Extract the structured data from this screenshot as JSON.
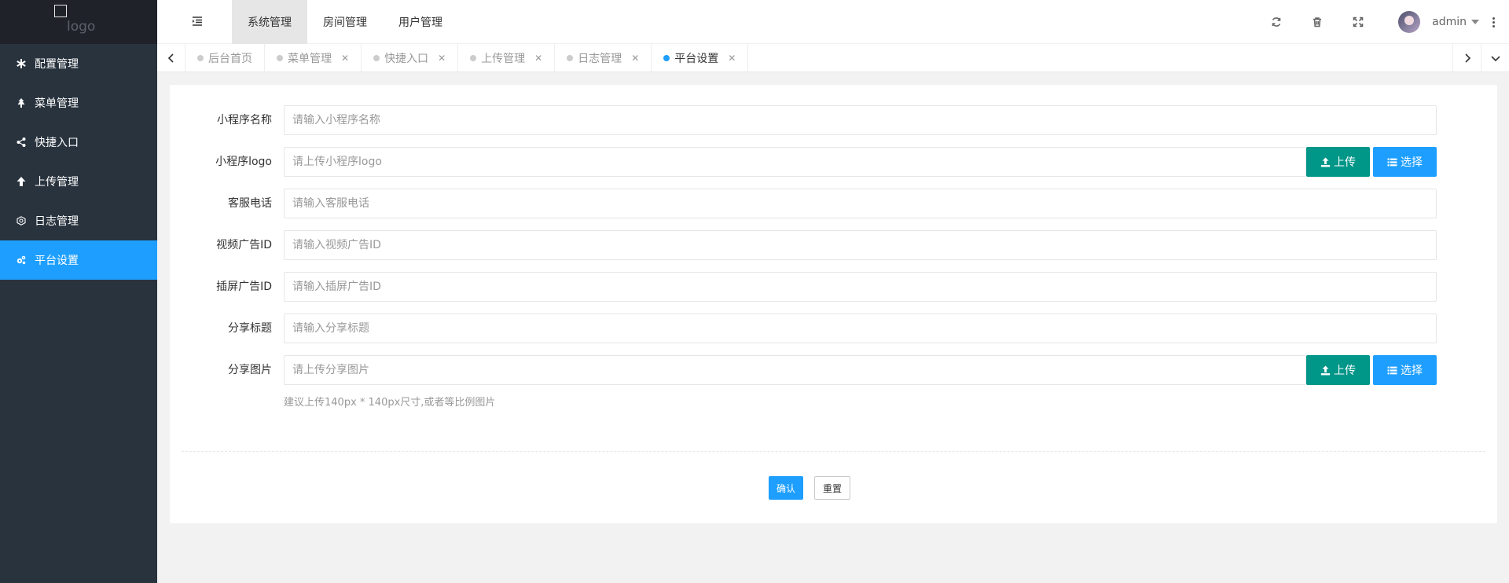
{
  "logo": {
    "text": "logo"
  },
  "sidebar": {
    "items": [
      {
        "label": "配置管理",
        "icon": "asterisk-icon"
      },
      {
        "label": "菜单管理",
        "icon": "tree-icon"
      },
      {
        "label": "快捷入口",
        "icon": "share-icon"
      },
      {
        "label": "上传管理",
        "icon": "arrow-up-icon"
      },
      {
        "label": "日志管理",
        "icon": "log-icon"
      },
      {
        "label": "平台设置",
        "icon": "gears-icon",
        "active": true
      }
    ]
  },
  "header": {
    "nav": [
      "系统管理",
      "房间管理",
      "用户管理"
    ],
    "active_nav": "系统管理",
    "user": "admin"
  },
  "tabs": [
    {
      "label": "后台首页",
      "closable": false
    },
    {
      "label": "菜单管理",
      "closable": true
    },
    {
      "label": "快捷入口",
      "closable": true
    },
    {
      "label": "上传管理",
      "closable": true
    },
    {
      "label": "日志管理",
      "closable": true
    },
    {
      "label": "平台设置",
      "closable": true,
      "active": true
    }
  ],
  "tab_close_symbol": "✕",
  "form": {
    "fields": [
      {
        "label": "小程序名称",
        "placeholder": "请输入小程序名称"
      },
      {
        "label": "小程序logo",
        "placeholder": "请上传小程序logo"
      },
      {
        "label": "客服电话",
        "placeholder": "请输入客服电话"
      },
      {
        "label": "视频广告ID",
        "placeholder": "请输入视频广告ID"
      },
      {
        "label": "插屏广告ID",
        "placeholder": "请输入插屏广告ID"
      },
      {
        "label": "分享标题",
        "placeholder": "请输入分享标题"
      },
      {
        "label": "分享图片",
        "placeholder": "请上传分享图片"
      }
    ],
    "upload_label": "上传",
    "select_label": "选择",
    "hint": "建议上传140px * 140px尺寸,或者等比例图片",
    "confirm_label": "确认",
    "reset_label": "重置"
  },
  "colors": {
    "sidebar_bg": "#28333e",
    "accent": "#1e9fff",
    "upload_green": "#009688"
  }
}
